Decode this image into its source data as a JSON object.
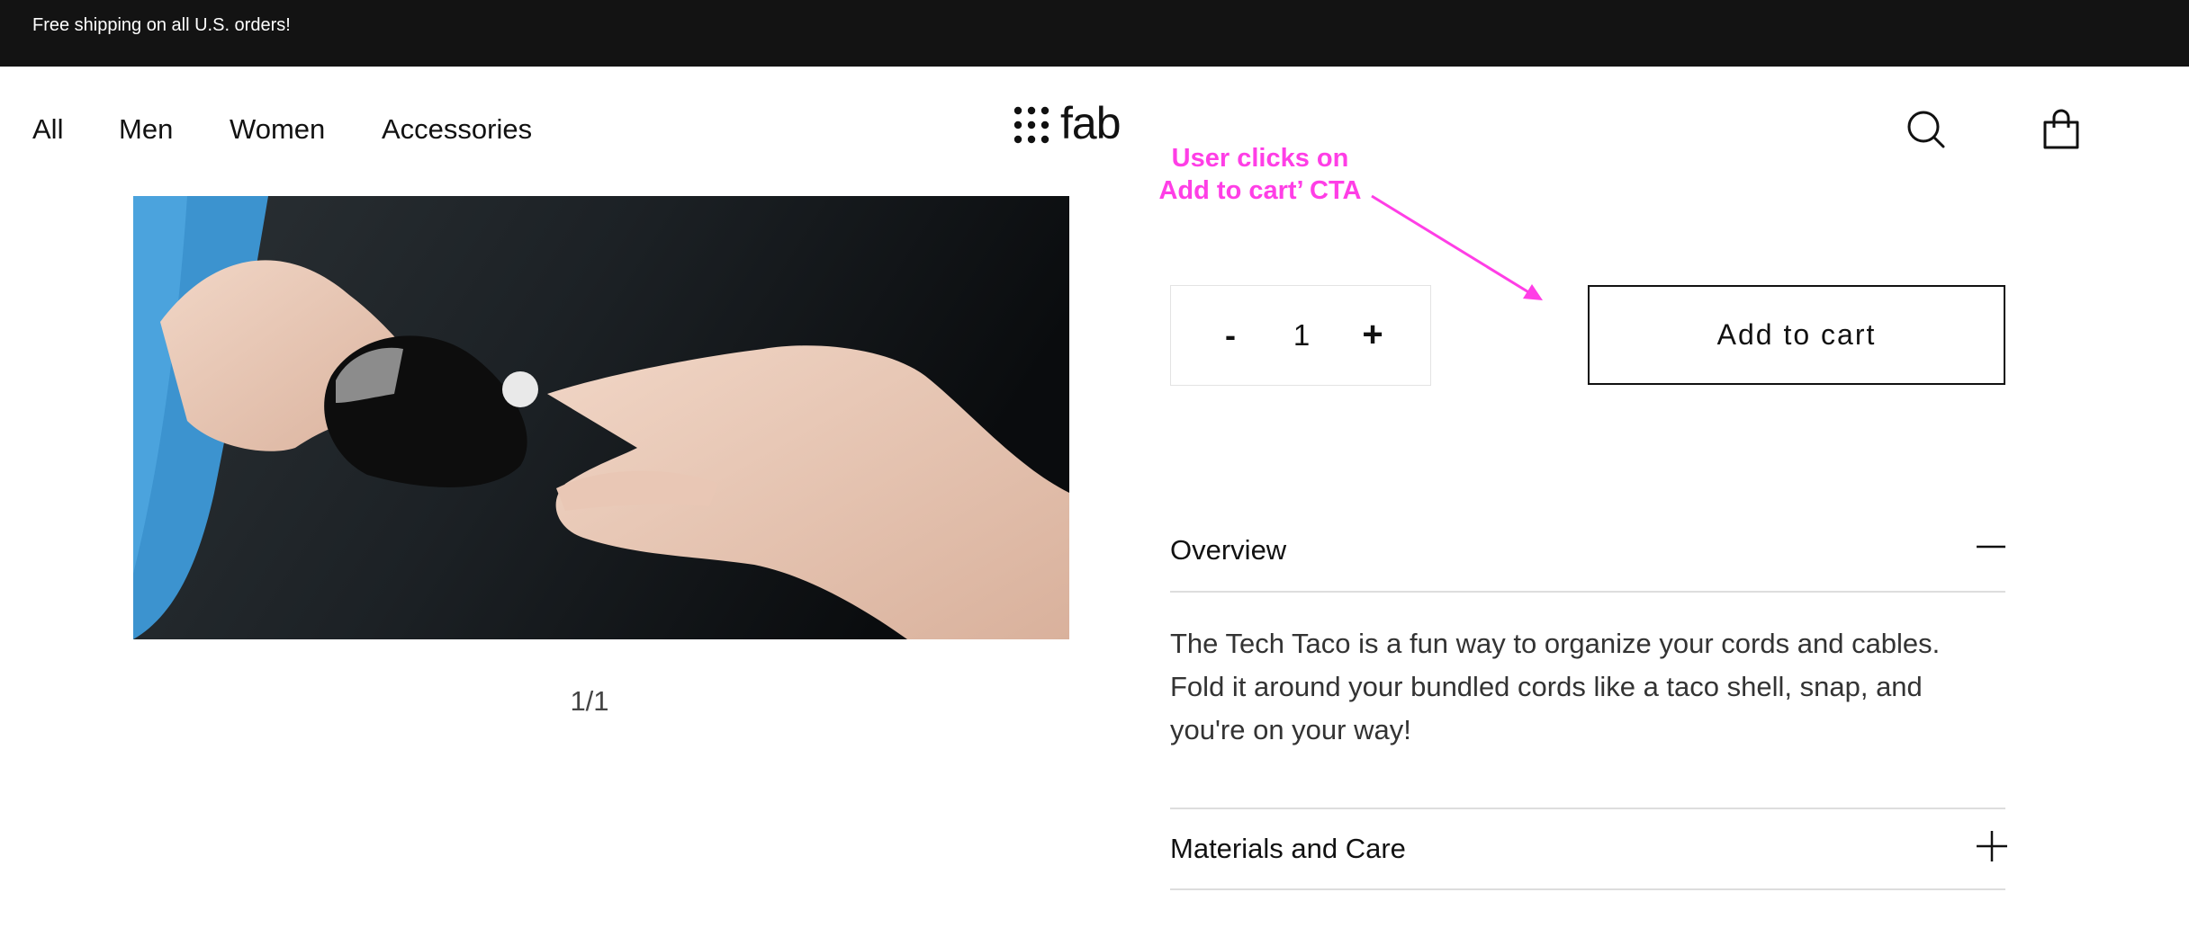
{
  "announcement": {
    "text": "Free shipping on all U.S. orders!"
  },
  "nav": {
    "items": [
      {
        "label": "All"
      },
      {
        "label": "Men"
      },
      {
        "label": "Women"
      },
      {
        "label": "Accessories"
      }
    ]
  },
  "logo": {
    "text": "fab",
    "icon": "nine-dot-grid-icon"
  },
  "header_icons": {
    "search": "search-icon",
    "cart": "shopping-bag-icon"
  },
  "annotation": {
    "line1": "User clicks on",
    "line2": "Add to cart’ CTA",
    "color": "#ff3ee6"
  },
  "gallery": {
    "counter": "1/1"
  },
  "quantity": {
    "minus": "-",
    "value": "1",
    "plus": "+"
  },
  "add_to_cart": {
    "label": "Add to cart"
  },
  "accordion": [
    {
      "title": "Overview",
      "expanded": true,
      "icon": "minus-icon",
      "body": "The Tech Taco is a fun way to organize your cords and cables. Fold it around your bundled cords like a taco shell, snap, and you're on your way!"
    },
    {
      "title": "Materials and Care",
      "expanded": false,
      "icon": "plus-icon"
    }
  ]
}
